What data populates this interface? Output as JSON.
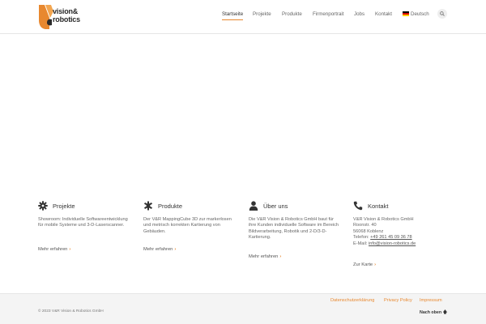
{
  "brand": {
    "logo_line1": "vision&",
    "logo_line2": "robotics",
    "accent_color": "#e8882f",
    "dark_color": "#2a2a2a"
  },
  "nav": {
    "items": [
      {
        "label": "Startseite",
        "active": true
      },
      {
        "label": "Projekte",
        "active": false
      },
      {
        "label": "Produkte",
        "active": false
      },
      {
        "label": "Firmenportrait",
        "active": false
      },
      {
        "label": "Jobs",
        "active": false
      },
      {
        "label": "Kontakt",
        "active": false
      }
    ],
    "language": "Deutsch",
    "language_icon": "german-flag-icon",
    "search_icon": "search-icon"
  },
  "widgets": {
    "projekte": {
      "icon": "gear-icon",
      "title": "Projekte",
      "text": "Showroom: Individuelle Softwareentwicklung für mobile Systeme und 3-D-Laserscanner.",
      "more": "Mehr erfahren"
    },
    "produkte": {
      "icon": "puzzle-icon",
      "title": "Produkte",
      "text": "Der V&R MappingCube 3D zur markerlosen und metrisch korrekten Kartierung von Gebäuden.",
      "more": "Mehr erfahren"
    },
    "ueber": {
      "icon": "user-icon",
      "title": "Über uns",
      "text": "Die V&R Vision & Robotics GmbH baut für ihre Kunden individuelle Software im Bereich Bildverarbeitung, Robotik und 2-D/3-D-Kartierung.",
      "more": "Mehr erfahren"
    },
    "kontakt": {
      "icon": "phone-icon",
      "title": "Kontakt",
      "company": "V&R Vision & Robotics GmbH",
      "street": "Roonstr. 40",
      "city": "56068 Koblenz",
      "phone_label": "Telefon: ",
      "phone": "+49 261 45 09 36 78",
      "email_label": "E-Mail: ",
      "email": "info@vision-robotics.de",
      "map": "Zur Karte"
    }
  },
  "footer": {
    "legal_links": [
      "Datenschutzerklärung",
      "Privacy Policy",
      "Impressum"
    ],
    "copyright": "© 2023 V&R Vision & Robotics GmbH",
    "back_to_top": "Nach oben"
  }
}
